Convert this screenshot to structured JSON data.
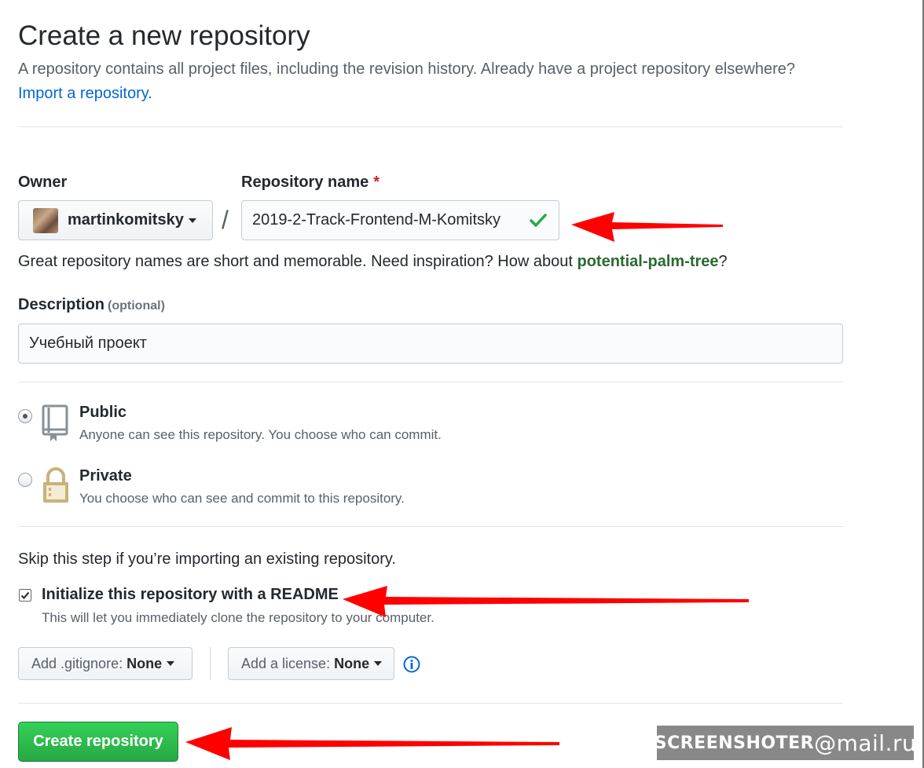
{
  "header": {
    "title": "Create a new repository",
    "subtitle": "A repository contains all project files, including the revision history. Already have a project repository elsewhere?",
    "import_link": "Import a repository."
  },
  "owner": {
    "label": "Owner",
    "value": "martinkomitsky"
  },
  "repo_name": {
    "label": "Repository name",
    "required_mark": "*",
    "value": "2019-2-Track-Frontend-M-Komitsky",
    "separator": "/"
  },
  "hint": {
    "text": "Great repository names are short and memorable. Need inspiration? How about ",
    "suggestion": "potential-palm-tree",
    "suffix": "?"
  },
  "description": {
    "label": "Description",
    "optional": "(optional)",
    "value": "Учебный проект"
  },
  "visibility": {
    "public": {
      "title": "Public",
      "desc": "Anyone can see this repository. You choose who can commit.",
      "selected": true
    },
    "private": {
      "title": "Private",
      "desc": "You choose who can see and commit to this repository.",
      "selected": false
    }
  },
  "init": {
    "skip_text": "Skip this step if you’re importing an existing repository.",
    "readme_label": "Initialize this repository with a README",
    "readme_desc": "This will let you immediately clone the repository to your computer.",
    "readme_checked": true
  },
  "gitignore": {
    "label": "Add .gitignore:",
    "value": "None"
  },
  "license": {
    "label": "Add a license:",
    "value": "None"
  },
  "submit": {
    "label": "Create repository"
  },
  "watermark": {
    "left": "SCREENSHOTER",
    "at": "@",
    "right": "mail.ru"
  },
  "colors": {
    "accent_link": "#0366d6",
    "primary_button": "#28a745",
    "suggestion": "#2b6a2f",
    "annotation_arrow": "#ff0000"
  }
}
